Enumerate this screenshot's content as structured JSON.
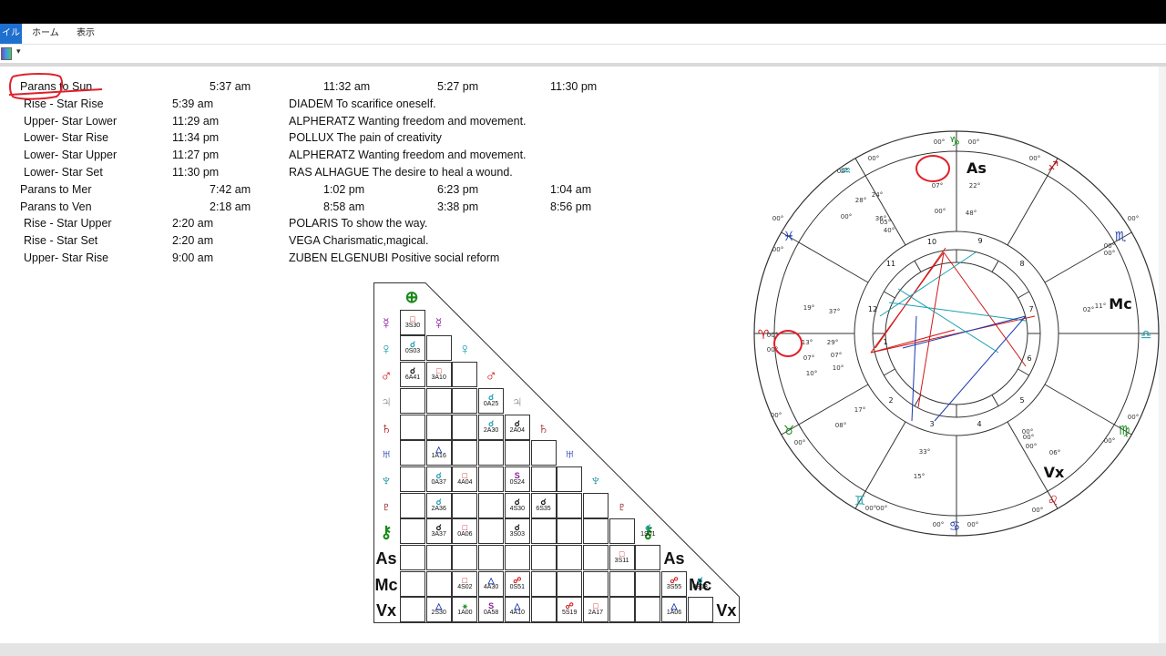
{
  "ribbon": {
    "file_label": "イル",
    "tabs": [
      "ホーム",
      "表示"
    ]
  },
  "colors": {
    "ribbon_active": "#1e6fd0",
    "annotation": "#e0202a"
  },
  "report": {
    "rows": [
      {
        "c1": "Parans to Sun",
        "c2": "5:37 am",
        "c3": "11:32 am",
        "c4": "5:27 pm",
        "c5": "11:30 pm"
      },
      {
        "c1": "Rise    - Star Rise",
        "c2": "5:39 am",
        "c3": "DIADEM To scarifice oneself."
      },
      {
        "c1": "Upper- Star Lower",
        "c2": "11:29 am",
        "c3": "ALPHERATZ Wanting freedom and movement."
      },
      {
        "c1": "Lower- Star Rise",
        "c2": "11:34 pm",
        "c3": "POLLUX The pain of creativity"
      },
      {
        "c1": "Lower- Star Upper",
        "c2": "11:27 pm",
        "c3": "ALPHERATZ Wanting freedom and movement."
      },
      {
        "c1": "Lower- Star Set",
        "c2": "11:30 pm",
        "c3": "RAS ALHAGUE The desire to heal a wound."
      },
      {
        "c1": "Parans to Mer",
        "c2": "7:42 am",
        "c3": "1:02 pm",
        "c4": "6:23 pm",
        "c5": "1:04 am"
      },
      {
        "c1": "Parans to Ven",
        "c2": "2:18 am",
        "c3": "8:58 am",
        "c4": "3:38 pm",
        "c5": "8:56 pm"
      },
      {
        "c1": "Rise    - Star Upper",
        "c2": "2:20 am",
        "c3": "POLARIS To show the way."
      },
      {
        "c1": "Rise    - Star Set",
        "c2": "2:20 am",
        "c3": "VEGA Charismatic,magical."
      },
      {
        "c1": "Upper- Star Rise",
        "c2": "9:00 am",
        "c3": "ZUBEN ELGENUBI Positive social reform"
      }
    ]
  },
  "aspect_grid": {
    "planets": [
      {
        "glyph": "⊕",
        "color": "#1a8a1a"
      },
      {
        "glyph": "☿",
        "color": "#8b1a9b"
      },
      {
        "glyph": "♀",
        "color": "#1aa0b0"
      },
      {
        "glyph": "♂",
        "color": "#d01818"
      },
      {
        "glyph": "♃",
        "color": "#888888"
      },
      {
        "glyph": "♄",
        "color": "#a01818"
      },
      {
        "glyph": "♅",
        "color": "#1a3ab0"
      },
      {
        "glyph": "♆",
        "color": "#1a8aa0"
      },
      {
        "glyph": "♇",
        "color": "#8b1a1a"
      },
      {
        "glyph": "⚷",
        "color": "#1a8a1a"
      },
      {
        "glyph": "As",
        "color": "#111111"
      },
      {
        "glyph": "Mc",
        "color": "#111111"
      },
      {
        "glyph": "Vx",
        "color": "#111111"
      }
    ],
    "aspects": [
      {
        "r": 1,
        "c": 0,
        "sym": "□",
        "label": "3S30",
        "color": "#d01818"
      },
      {
        "r": 2,
        "c": 0,
        "sym": "☌",
        "label": "0S03",
        "color": "#1aa0b0"
      },
      {
        "r": 3,
        "c": 0,
        "sym": "☌",
        "label": "6A41",
        "color": "#111111"
      },
      {
        "r": 3,
        "c": 1,
        "sym": "□",
        "label": "3A10",
        "color": "#d01818"
      },
      {
        "r": 4,
        "c": 3,
        "sym": "☌",
        "label": "0A25",
        "color": "#1aa0b0"
      },
      {
        "r": 5,
        "c": 3,
        "sym": "☌",
        "label": "2A30",
        "color": "#1aa0b0"
      },
      {
        "r": 5,
        "c": 4,
        "sym": "☌",
        "label": "2A04",
        "color": "#111111"
      },
      {
        "r": 6,
        "c": 1,
        "sym": "△",
        "label": "1A16",
        "color": "#1a3ab0"
      },
      {
        "r": 7,
        "c": 1,
        "sym": "☌",
        "label": "0A37",
        "color": "#1aa0b0"
      },
      {
        "r": 7,
        "c": 2,
        "sym": "□",
        "label": "4A04",
        "color": "#d01818"
      },
      {
        "r": 7,
        "c": 4,
        "sym": "S",
        "label": "0S24",
        "color": "#8b1a9b"
      },
      {
        "r": 8,
        "c": 1,
        "sym": "☌",
        "label": "2A36",
        "color": "#1aa0b0"
      },
      {
        "r": 8,
        "c": 4,
        "sym": "☌",
        "label": "4S30",
        "color": "#111111"
      },
      {
        "r": 8,
        "c": 5,
        "sym": "☌",
        "label": "6S35",
        "color": "#111111"
      },
      {
        "r": 9,
        "c": 1,
        "sym": "☌",
        "label": "3A37",
        "color": "#111111"
      },
      {
        "r": 9,
        "c": 2,
        "sym": "□",
        "label": "0A06",
        "color": "#d01818"
      },
      {
        "r": 9,
        "c": 4,
        "sym": "☌",
        "label": "3S03",
        "color": "#111111"
      },
      {
        "r": 9,
        "c": 9,
        "sym": "☌",
        "label": "1S01",
        "color": "#1aa0b0"
      },
      {
        "r": 10,
        "c": 8,
        "sym": "□",
        "label": "3S11",
        "color": "#d01818"
      },
      {
        "r": 11,
        "c": 2,
        "sym": "□",
        "label": "4S02",
        "color": "#d01818"
      },
      {
        "r": 11,
        "c": 3,
        "sym": "△",
        "label": "4A30",
        "color": "#1a3ab0"
      },
      {
        "r": 11,
        "c": 4,
        "sym": "☍",
        "label": "0S51",
        "color": "#d01818"
      },
      {
        "r": 11,
        "c": 10,
        "sym": "☍",
        "label": "3S55",
        "color": "#d01818"
      },
      {
        "r": 11,
        "c": 11,
        "sym": "☌",
        "label": "0S13",
        "color": "#1aa0b0"
      },
      {
        "r": 12,
        "c": 1,
        "sym": "△",
        "label": "2S30",
        "color": "#1a3ab0"
      },
      {
        "r": 12,
        "c": 2,
        "sym": "⚹",
        "label": "1A00",
        "color": "#1a8a1a"
      },
      {
        "r": 12,
        "c": 3,
        "sym": "S",
        "label": "0A58",
        "color": "#8b1a9b"
      },
      {
        "r": 12,
        "c": 4,
        "sym": "△",
        "label": "4A10",
        "color": "#1a3ab0"
      },
      {
        "r": 12,
        "c": 6,
        "sym": "☍",
        "label": "5S19",
        "color": "#d01818"
      },
      {
        "r": 12,
        "c": 7,
        "sym": "□",
        "label": "2A17",
        "color": "#d01818"
      },
      {
        "r": 12,
        "c": 10,
        "sym": "△",
        "label": "1A06",
        "color": "#1a3ab0"
      }
    ]
  },
  "wheel": {
    "house_numbers": [
      "1",
      "2",
      "3",
      "4",
      "5",
      "6",
      "7",
      "8",
      "9",
      "10",
      "11",
      "12"
    ],
    "angles_labels": {
      "asc": "As",
      "mc": "Mc",
      "vx": "Vx"
    },
    "degree_labels": [
      "00°",
      "00°",
      "00°",
      "00°",
      "00°",
      "00°",
      "00°",
      "00°",
      "00°",
      "00°",
      "00°",
      "00°",
      "00°",
      "00°",
      "00°",
      "00°",
      "00°",
      "00°",
      "00°",
      "00°",
      "00°",
      "00°",
      "00°",
      "00°"
    ],
    "planet_degrees": [
      "07°",
      "00°",
      "22°",
      "48°",
      "24°",
      "28°",
      "05°",
      "36°",
      "40°",
      "19°",
      "37°",
      "13°",
      "29°",
      "07°",
      "07°",
      "10°",
      "10°",
      "08°",
      "17°",
      "33°",
      "15°",
      "02°",
      "11°",
      "06°",
      "00°"
    ],
    "signs": [
      "♑",
      "♒",
      "♓",
      "♈",
      "♉",
      "♊",
      "♋",
      "♌",
      "♍",
      "♎",
      "♏",
      "♐"
    ]
  }
}
